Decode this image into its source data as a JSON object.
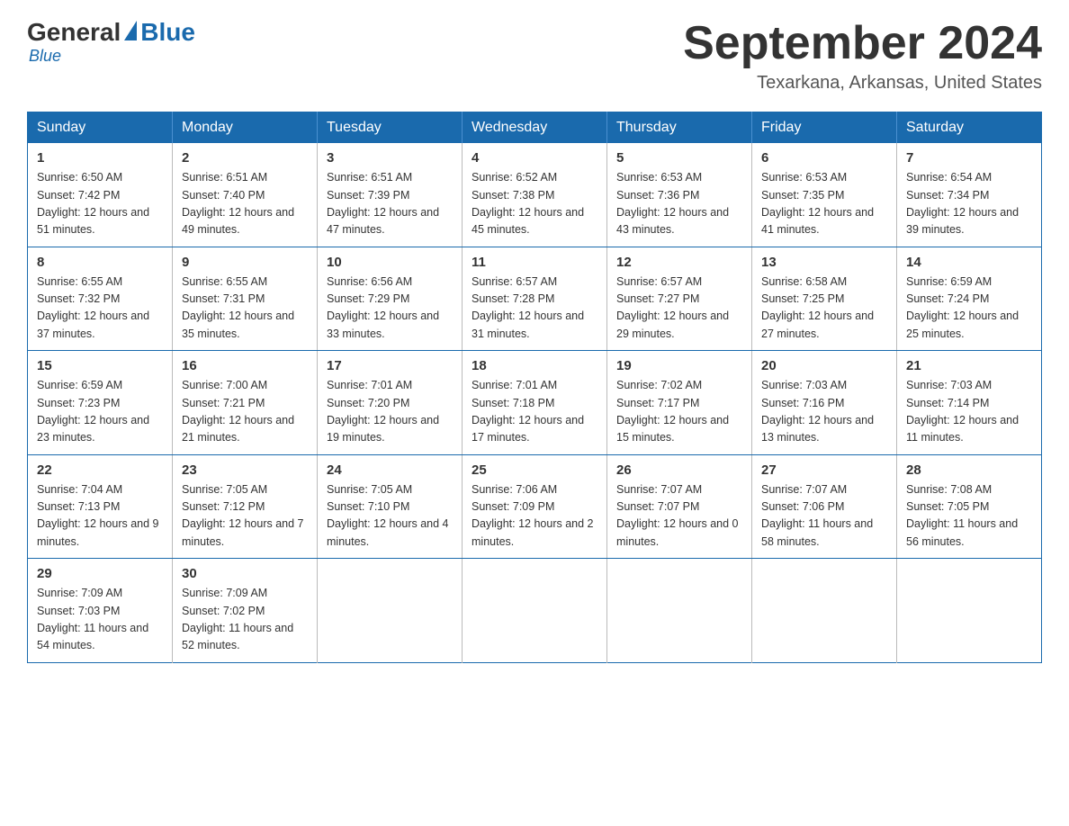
{
  "header": {
    "logo": {
      "general": "General",
      "blue": "Blue",
      "sub": "Blue"
    },
    "title": "September 2024",
    "location": "Texarkana, Arkansas, United States"
  },
  "weekdays": [
    "Sunday",
    "Monday",
    "Tuesday",
    "Wednesday",
    "Thursday",
    "Friday",
    "Saturday"
  ],
  "weeks": [
    [
      {
        "day": "1",
        "sunrise": "6:50 AM",
        "sunset": "7:42 PM",
        "daylight": "12 hours and 51 minutes."
      },
      {
        "day": "2",
        "sunrise": "6:51 AM",
        "sunset": "7:40 PM",
        "daylight": "12 hours and 49 minutes."
      },
      {
        "day": "3",
        "sunrise": "6:51 AM",
        "sunset": "7:39 PM",
        "daylight": "12 hours and 47 minutes."
      },
      {
        "day": "4",
        "sunrise": "6:52 AM",
        "sunset": "7:38 PM",
        "daylight": "12 hours and 45 minutes."
      },
      {
        "day": "5",
        "sunrise": "6:53 AM",
        "sunset": "7:36 PM",
        "daylight": "12 hours and 43 minutes."
      },
      {
        "day": "6",
        "sunrise": "6:53 AM",
        "sunset": "7:35 PM",
        "daylight": "12 hours and 41 minutes."
      },
      {
        "day": "7",
        "sunrise": "6:54 AM",
        "sunset": "7:34 PM",
        "daylight": "12 hours and 39 minutes."
      }
    ],
    [
      {
        "day": "8",
        "sunrise": "6:55 AM",
        "sunset": "7:32 PM",
        "daylight": "12 hours and 37 minutes."
      },
      {
        "day": "9",
        "sunrise": "6:55 AM",
        "sunset": "7:31 PM",
        "daylight": "12 hours and 35 minutes."
      },
      {
        "day": "10",
        "sunrise": "6:56 AM",
        "sunset": "7:29 PM",
        "daylight": "12 hours and 33 minutes."
      },
      {
        "day": "11",
        "sunrise": "6:57 AM",
        "sunset": "7:28 PM",
        "daylight": "12 hours and 31 minutes."
      },
      {
        "day": "12",
        "sunrise": "6:57 AM",
        "sunset": "7:27 PM",
        "daylight": "12 hours and 29 minutes."
      },
      {
        "day": "13",
        "sunrise": "6:58 AM",
        "sunset": "7:25 PM",
        "daylight": "12 hours and 27 minutes."
      },
      {
        "day": "14",
        "sunrise": "6:59 AM",
        "sunset": "7:24 PM",
        "daylight": "12 hours and 25 minutes."
      }
    ],
    [
      {
        "day": "15",
        "sunrise": "6:59 AM",
        "sunset": "7:23 PM",
        "daylight": "12 hours and 23 minutes."
      },
      {
        "day": "16",
        "sunrise": "7:00 AM",
        "sunset": "7:21 PM",
        "daylight": "12 hours and 21 minutes."
      },
      {
        "day": "17",
        "sunrise": "7:01 AM",
        "sunset": "7:20 PM",
        "daylight": "12 hours and 19 minutes."
      },
      {
        "day": "18",
        "sunrise": "7:01 AM",
        "sunset": "7:18 PM",
        "daylight": "12 hours and 17 minutes."
      },
      {
        "day": "19",
        "sunrise": "7:02 AM",
        "sunset": "7:17 PM",
        "daylight": "12 hours and 15 minutes."
      },
      {
        "day": "20",
        "sunrise": "7:03 AM",
        "sunset": "7:16 PM",
        "daylight": "12 hours and 13 minutes."
      },
      {
        "day": "21",
        "sunrise": "7:03 AM",
        "sunset": "7:14 PM",
        "daylight": "12 hours and 11 minutes."
      }
    ],
    [
      {
        "day": "22",
        "sunrise": "7:04 AM",
        "sunset": "7:13 PM",
        "daylight": "12 hours and 9 minutes."
      },
      {
        "day": "23",
        "sunrise": "7:05 AM",
        "sunset": "7:12 PM",
        "daylight": "12 hours and 7 minutes."
      },
      {
        "day": "24",
        "sunrise": "7:05 AM",
        "sunset": "7:10 PM",
        "daylight": "12 hours and 4 minutes."
      },
      {
        "day": "25",
        "sunrise": "7:06 AM",
        "sunset": "7:09 PM",
        "daylight": "12 hours and 2 minutes."
      },
      {
        "day": "26",
        "sunrise": "7:07 AM",
        "sunset": "7:07 PM",
        "daylight": "12 hours and 0 minutes."
      },
      {
        "day": "27",
        "sunrise": "7:07 AM",
        "sunset": "7:06 PM",
        "daylight": "11 hours and 58 minutes."
      },
      {
        "day": "28",
        "sunrise": "7:08 AM",
        "sunset": "7:05 PM",
        "daylight": "11 hours and 56 minutes."
      }
    ],
    [
      {
        "day": "29",
        "sunrise": "7:09 AM",
        "sunset": "7:03 PM",
        "daylight": "11 hours and 54 minutes."
      },
      {
        "day": "30",
        "sunrise": "7:09 AM",
        "sunset": "7:02 PM",
        "daylight": "11 hours and 52 minutes."
      },
      null,
      null,
      null,
      null,
      null
    ]
  ]
}
